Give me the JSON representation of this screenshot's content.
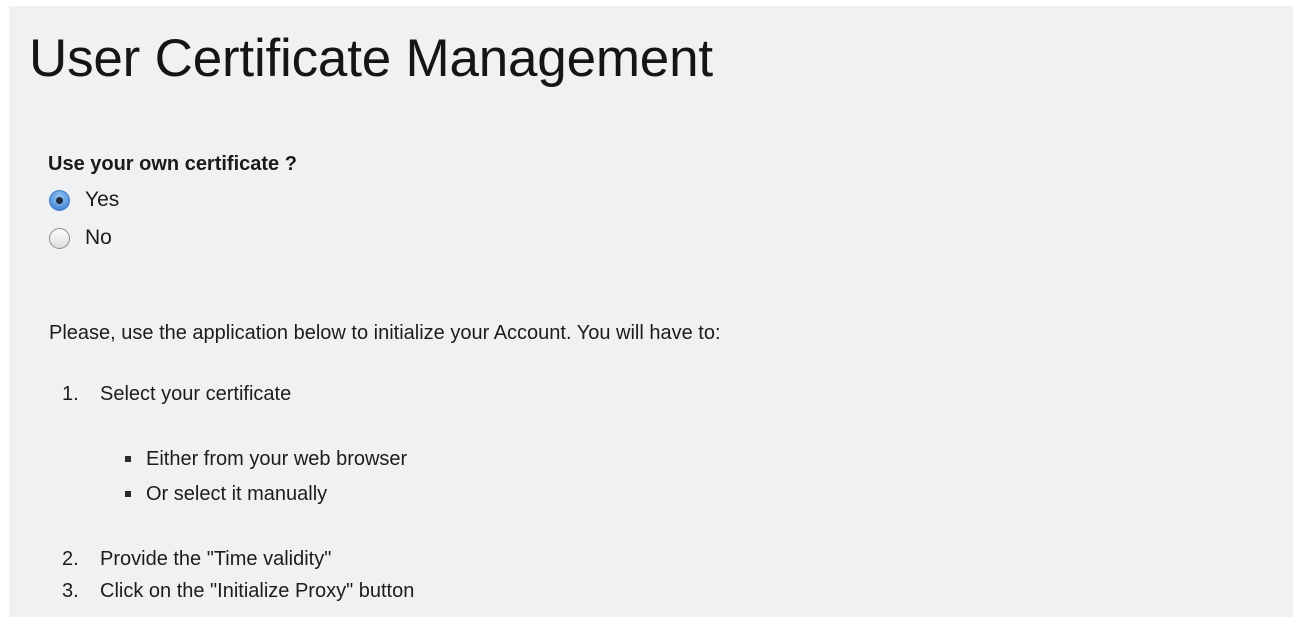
{
  "page_title": "User Certificate Management",
  "certificate_choice": {
    "question": "Use your own certificate ?",
    "options": [
      {
        "label": "Yes",
        "checked": true
      },
      {
        "label": "No",
        "checked": false
      }
    ]
  },
  "instructions": {
    "intro": "Please, use the application below to initialize your Account. You will have to:",
    "steps": [
      {
        "number": "1.",
        "text": "Select your certificate"
      },
      {
        "number": "2.",
        "text": "Provide the \"Time validity\""
      },
      {
        "number": "3.",
        "text": "Click on the \"Initialize Proxy\" button"
      }
    ],
    "substeps": [
      "Either from your web browser",
      "Or select it manually"
    ]
  },
  "colors": {
    "background": "#eff1f3",
    "radio_accent": "#4d8fd8",
    "text": "#1c1c1c"
  }
}
